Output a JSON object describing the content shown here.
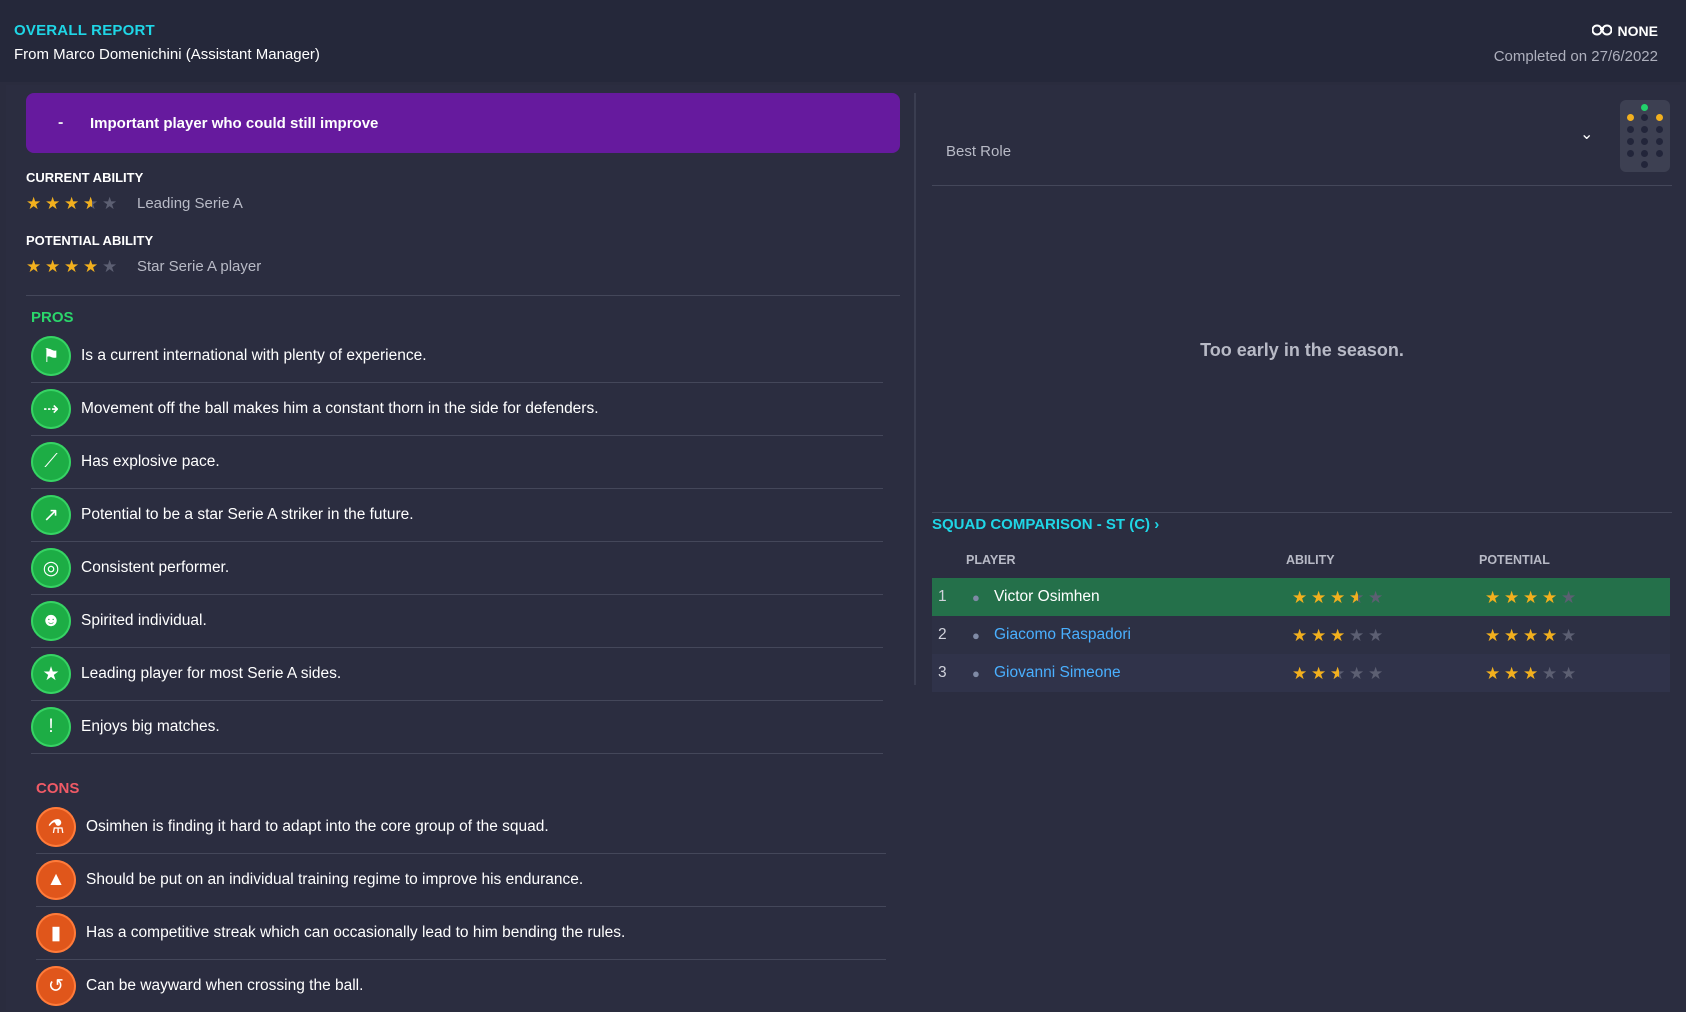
{
  "header": {
    "title": "OVERALL REPORT",
    "subtitle": "From Marco Domenichini (Assistant Manager)",
    "scout_status": "NONE",
    "completed": "Completed on 27/6/2022"
  },
  "banner": {
    "dash": "-",
    "text": "Important player who could still improve"
  },
  "current_ability": {
    "label": "CURRENT ABILITY",
    "stars": 3.5,
    "text": "Leading Serie A"
  },
  "potential_ability": {
    "label": "POTENTIAL ABILITY",
    "stars": 4,
    "text": "Star Serie A player"
  },
  "pros": {
    "title": "PROS",
    "items": [
      {
        "icon": "flag-icon",
        "text": "Is a current international with plenty of experience."
      },
      {
        "icon": "movement-icon",
        "text": "Movement off the ball makes him a constant thorn in the side for defenders."
      },
      {
        "icon": "boot-icon",
        "text": "Has explosive pace."
      },
      {
        "icon": "trend-up-icon",
        "text": "Potential to be a star Serie A striker in the future."
      },
      {
        "icon": "target-icon",
        "text": "Consistent performer."
      },
      {
        "icon": "head-icon",
        "text": "Spirited individual."
      },
      {
        "icon": "star-icon",
        "text": "Leading player for most Serie A sides."
      },
      {
        "icon": "big-match-icon",
        "text": "Enjoys big matches."
      }
    ]
  },
  "cons": {
    "title": "CONS",
    "items": [
      {
        "icon": "flask-icon",
        "text": "Osimhen is finding it hard to adapt into the core group of the squad."
      },
      {
        "icon": "training-icon",
        "text": "Should be put on an individual training regime to improve his endurance."
      },
      {
        "icon": "card-icon",
        "text": "Has a competitive streak which can occasionally lead to him bending the rules."
      },
      {
        "icon": "cross-ball-icon",
        "text": "Can be wayward when crossing the ball."
      }
    ]
  },
  "best_role": {
    "label": "Best Role"
  },
  "early_message": "Too early in the season.",
  "squad": {
    "title": "SQUAD COMPARISON - ST (C)",
    "columns": [
      "PLAYER",
      "ABILITY",
      "POTENTIAL"
    ],
    "rows": [
      {
        "num": "1",
        "name": "Victor Osimhen",
        "ability": 3.5,
        "potential": 4
      },
      {
        "num": "2",
        "name": "Giacomo Raspadori",
        "ability": 3,
        "potential": 4
      },
      {
        "num": "3",
        "name": "Giovanni Simeone",
        "ability": 2.5,
        "potential": 3
      }
    ]
  },
  "colors": {
    "accent": "#1fd6e6",
    "banner": "#661a9e",
    "pro": "#2bd66b",
    "con": "#f05a66",
    "highlight_row": "#24704a",
    "star": "#f2b01e"
  }
}
